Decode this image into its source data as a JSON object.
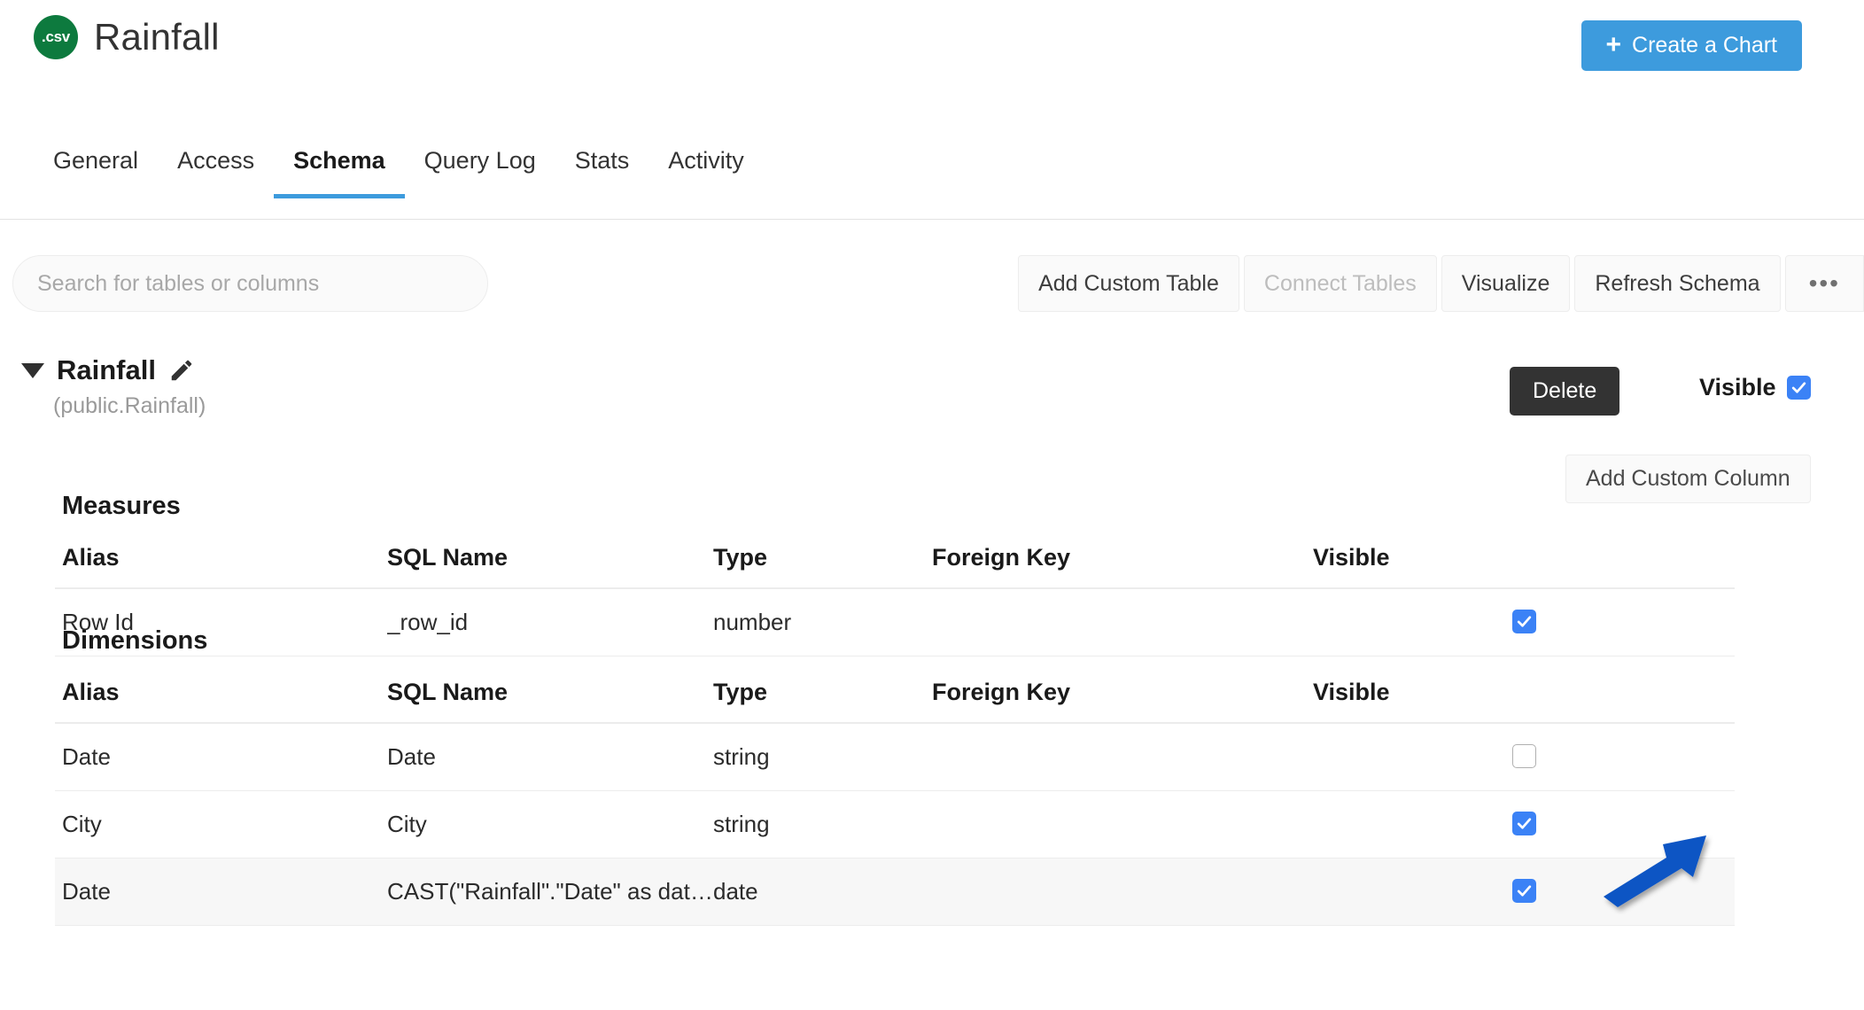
{
  "header": {
    "badge_text": ".csv",
    "badge_color": "#0d7a3e",
    "title": "Rainfall",
    "create_chart_label": "Create a Chart",
    "create_chart_plus": "+",
    "accent_color": "#3d9bdd"
  },
  "tabs": [
    {
      "label": "General",
      "active": false
    },
    {
      "label": "Access",
      "active": false
    },
    {
      "label": "Schema",
      "active": true
    },
    {
      "label": "Query Log",
      "active": false
    },
    {
      "label": "Stats",
      "active": false
    },
    {
      "label": "Activity",
      "active": false
    }
  ],
  "toolbar": {
    "search_placeholder": "Search for tables or columns",
    "search_value": "",
    "buttons": [
      {
        "label": "Add Custom Table",
        "disabled": false
      },
      {
        "label": "Connect Tables",
        "disabled": true
      },
      {
        "label": "Visualize",
        "disabled": false
      },
      {
        "label": "Refresh Schema",
        "disabled": false
      }
    ],
    "overflow_label": "•••"
  },
  "table_header": {
    "name": "Rainfall",
    "qualified_name": "(public.Rainfall)",
    "expanded": true,
    "delete_label": "Delete",
    "visible_label": "Visible",
    "visible_checked": true,
    "add_custom_column_label": "Add Custom Column"
  },
  "columns": {
    "alias": "Alias",
    "sql_name": "SQL Name",
    "type": "Type",
    "foreign_key": "Foreign Key",
    "visible": "Visible"
  },
  "sections": [
    {
      "title": "Measures",
      "rows": [
        {
          "alias": "Row Id",
          "sql_name": "_row_id",
          "type": "number",
          "foreign_key": "",
          "visible": true,
          "custom": false
        }
      ]
    },
    {
      "title": "Dimensions",
      "rows": [
        {
          "alias": "Date",
          "sql_name": "Date",
          "type": "string",
          "foreign_key": "",
          "visible": false,
          "custom": false
        },
        {
          "alias": "City",
          "sql_name": "City",
          "type": "string",
          "foreign_key": "",
          "visible": true,
          "custom": false
        },
        {
          "alias": "Date",
          "sql_name": "CAST(\"Rainfall\".\"Date\" as date...",
          "type": "date",
          "foreign_key": "",
          "visible": true,
          "custom": true
        }
      ]
    }
  ],
  "annotation": {
    "arrow_color": "#0b55c4",
    "points_to": "Date dimension visible checkbox"
  }
}
